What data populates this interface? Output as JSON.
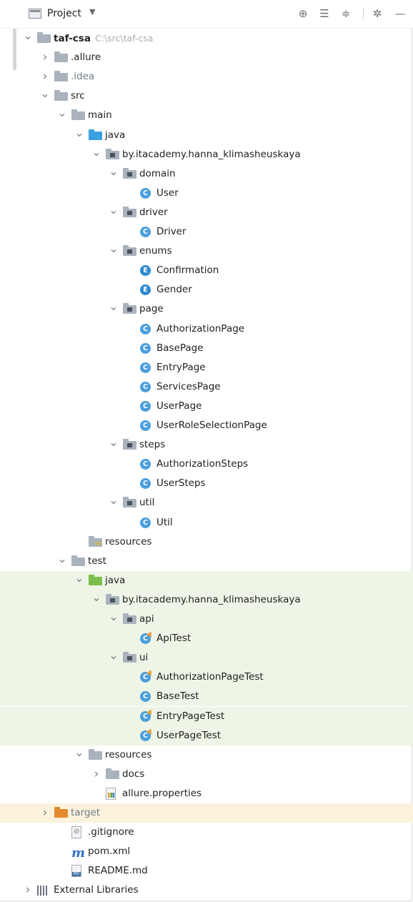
{
  "toolbar": {
    "title": "Project",
    "caret": "▼",
    "icons": [
      "target-icon",
      "expand-all-icon",
      "collapse-all-icon",
      "gear-icon",
      "minimize-icon"
    ]
  },
  "tree": [
    {
      "label": "taf-csa",
      "hint": "C:\\src\\taf-csa",
      "depth": 0,
      "chevron": "down",
      "icon": "folder-grey",
      "bold": true
    },
    {
      "label": ".allure",
      "depth": 1,
      "chevron": "right",
      "icon": "folder-grey"
    },
    {
      "label": ".idea",
      "depth": 1,
      "chevron": "right",
      "icon": "folder-grey",
      "muted": true
    },
    {
      "label": "src",
      "depth": 1,
      "chevron": "down",
      "icon": "folder-grey"
    },
    {
      "label": "main",
      "depth": 2,
      "chevron": "down",
      "icon": "folder-grey"
    },
    {
      "label": "java",
      "depth": 3,
      "chevron": "down",
      "icon": "folder-blue"
    },
    {
      "label": "by.itacademy.hanna_klimasheuskaya",
      "depth": 4,
      "chevron": "down",
      "icon": "package"
    },
    {
      "label": "domain",
      "depth": 5,
      "chevron": "down",
      "icon": "package"
    },
    {
      "label": "User",
      "depth": 6,
      "icon": "class"
    },
    {
      "label": "driver",
      "depth": 5,
      "chevron": "down",
      "icon": "package"
    },
    {
      "label": "Driver",
      "depth": 6,
      "icon": "class"
    },
    {
      "label": "enums",
      "depth": 5,
      "chevron": "down",
      "icon": "package"
    },
    {
      "label": "Confirmation",
      "depth": 6,
      "icon": "enum"
    },
    {
      "label": "Gender",
      "depth": 6,
      "icon": "enum"
    },
    {
      "label": "page",
      "depth": 5,
      "chevron": "down",
      "icon": "package"
    },
    {
      "label": "AuthorizationPage",
      "depth": 6,
      "icon": "class"
    },
    {
      "label": "BasePage",
      "depth": 6,
      "icon": "class"
    },
    {
      "label": "EntryPage",
      "depth": 6,
      "icon": "class"
    },
    {
      "label": "ServicesPage",
      "depth": 6,
      "icon": "class"
    },
    {
      "label": "UserPage",
      "depth": 6,
      "icon": "class"
    },
    {
      "label": "UserRoleSelectionPage",
      "depth": 6,
      "icon": "class"
    },
    {
      "label": "steps",
      "depth": 5,
      "chevron": "down",
      "icon": "package"
    },
    {
      "label": "AuthorizationSteps",
      "depth": 6,
      "icon": "class"
    },
    {
      "label": "UserSteps",
      "depth": 6,
      "icon": "class"
    },
    {
      "label": "util",
      "depth": 5,
      "chevron": "down",
      "icon": "package"
    },
    {
      "label": "Util",
      "depth": 6,
      "icon": "class"
    },
    {
      "label": "resources",
      "depth": 3,
      "icon": "folder-resources"
    },
    {
      "label": "test",
      "depth": 2,
      "chevron": "down",
      "icon": "folder-grey"
    },
    {
      "label": "java",
      "depth": 3,
      "chevron": "down",
      "icon": "folder-green",
      "highlight": true
    },
    {
      "label": "by.itacademy.hanna_klimasheuskaya",
      "depth": 4,
      "chevron": "down",
      "icon": "package",
      "highlight": true
    },
    {
      "label": "api",
      "depth": 5,
      "chevron": "down",
      "icon": "package",
      "highlight": true
    },
    {
      "label": "ApiTest",
      "depth": 6,
      "icon": "test-class",
      "highlight": true
    },
    {
      "label": "ui",
      "depth": 5,
      "chevron": "down",
      "icon": "package",
      "highlight": true
    },
    {
      "label": "AuthorizationPageTest",
      "depth": 6,
      "icon": "test-class",
      "highlight": true
    },
    {
      "label": "BaseTest",
      "depth": 6,
      "icon": "class",
      "highlight": true
    },
    {
      "label": "EntryPageTest",
      "depth": 6,
      "icon": "test-class",
      "highlight": true
    },
    {
      "label": "UserPageTest",
      "depth": 6,
      "icon": "test-class",
      "highlight": true
    },
    {
      "label": "resources",
      "depth": 3,
      "chevron": "down",
      "icon": "folder-grey"
    },
    {
      "label": "docs",
      "depth": 4,
      "chevron": "right",
      "icon": "folder-grey"
    },
    {
      "label": "allure.properties",
      "depth": 4,
      "icon": "properties-file"
    },
    {
      "label": "target",
      "depth": 1,
      "chevron": "right",
      "icon": "folder-orange",
      "muted": true,
      "rowhl": "orange"
    },
    {
      "label": ".gitignore",
      "depth": 2,
      "icon": "gitignore-file"
    },
    {
      "label": "pom.xml",
      "depth": 2,
      "icon": "maven-file"
    },
    {
      "label": "README.md",
      "depth": 2,
      "icon": "markdown-file"
    },
    {
      "label": "External Libraries",
      "depth": 0,
      "chevron": "right",
      "icon": "libraries"
    }
  ],
  "colors": {
    "highlight_bg": "#eef5e6",
    "target_bg": "#fbf2dc",
    "accent": "#3d9fe3"
  }
}
